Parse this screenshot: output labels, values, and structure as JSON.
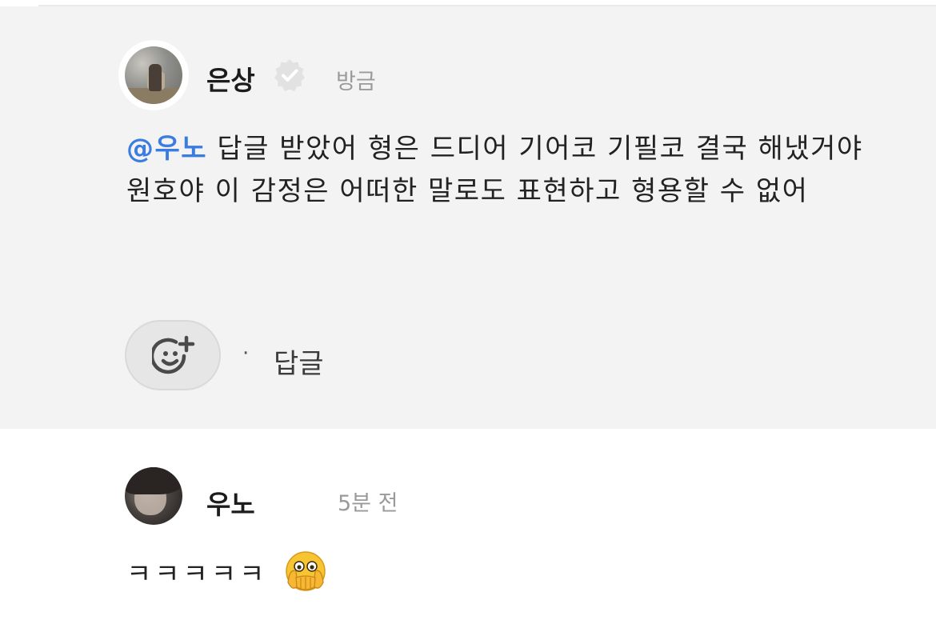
{
  "comment_1": {
    "username": "은상",
    "verified_icon": "verified-badge-icon",
    "timestamp": "방금",
    "mention": "@우노",
    "text": " 답글 받았어 형은 드디어 기어코 기필코 결국 해냈거야 원호야 이 감정은 어떠한 말로도 표현하고 형용할 수 없어",
    "reaction_icon": "add-reaction-icon",
    "separator": "·",
    "reply_label": "답글"
  },
  "comment_2": {
    "username": "우노",
    "timestamp": "5분 전",
    "text": "ㅋㅋㅋㅋㅋ",
    "emoji_icon": "face-with-open-eyes-and-hand-over-mouth-emoji"
  },
  "colors": {
    "highlight_background": "#f3f3f3",
    "mention": "#3b7ce0",
    "timestamp": "#9a9a9a",
    "text": "#222222"
  }
}
